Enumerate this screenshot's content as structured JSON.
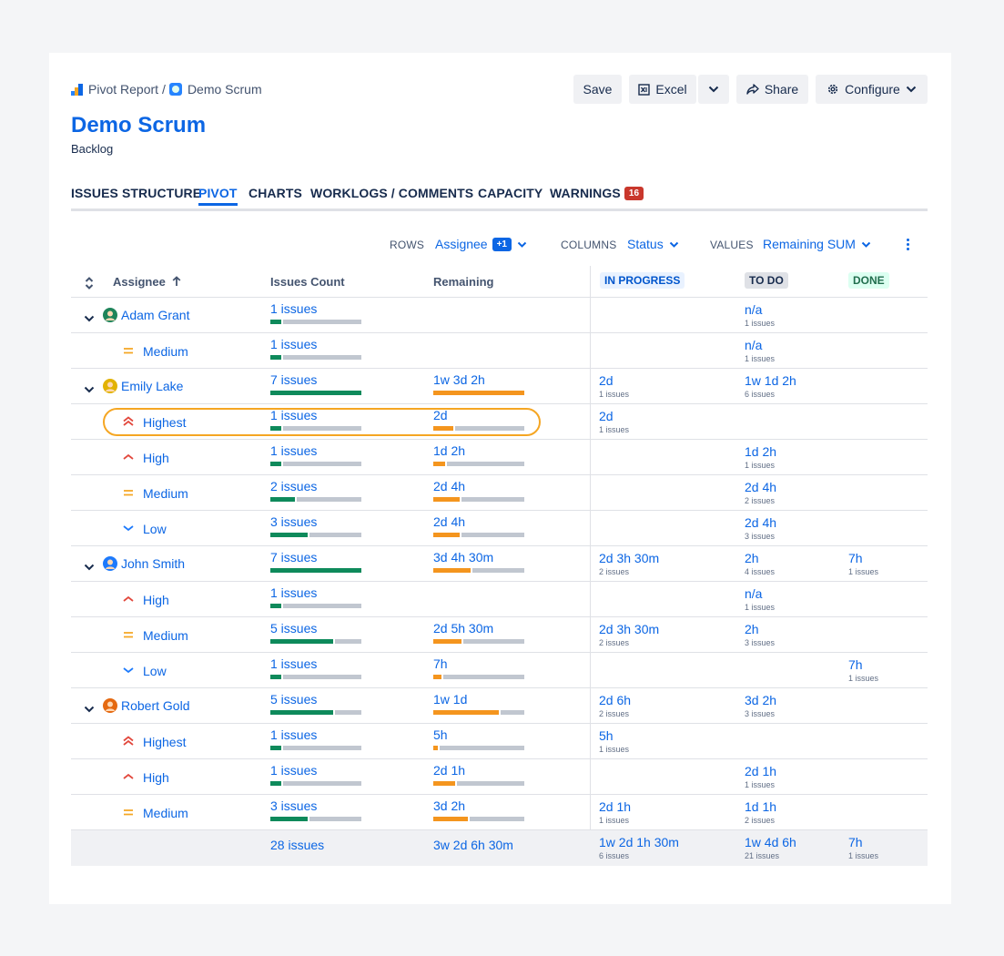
{
  "breadcrumbs": {
    "app": "Pivot Report",
    "separator": "/",
    "project": "Demo Scrum"
  },
  "toolbar": {
    "save": "Save",
    "excel": "Excel",
    "share": "Share",
    "configure": "Configure"
  },
  "page": {
    "title": "Demo Scrum",
    "subtitle": "Backlog"
  },
  "tabs": [
    {
      "label": "ISSUES STRUCTURE",
      "active": false
    },
    {
      "label": "PIVOT",
      "active": true
    },
    {
      "label": "CHARTS",
      "active": false
    },
    {
      "label": "WORKLOGS / COMMENTS",
      "active": false
    },
    {
      "label": "CAPACITY",
      "active": false
    },
    {
      "label": "WARNINGS",
      "active": false,
      "badge": "16"
    }
  ],
  "controls": {
    "rows_label": "ROWS",
    "rows_value": "Assignee",
    "rows_extra": "+1",
    "columns_label": "COLUMNS",
    "columns_value": "Status",
    "values_label": "VALUES",
    "values_value": "Remaining SUM"
  },
  "table": {
    "headers": {
      "assignee": "Assignee",
      "count": "Issues Count",
      "remaining": "Remaining",
      "in_progress": "IN PROGRESS",
      "todo": "TO DO",
      "done": "DONE"
    },
    "colors": {
      "count_bar": "#0e8a5b",
      "remaining_bar": "#f4951e",
      "link": "#0c66e4",
      "highlight": "#f5a623"
    },
    "rows": [
      {
        "level": 0,
        "label": "Adam Grant",
        "avatar": "#1f845a",
        "count": "1 issues",
        "count_pct": 0.14,
        "remaining": "",
        "remaining_pct": null,
        "ip": "",
        "ip_sub": "",
        "todo": "n/a",
        "todo_sub": "1 issues",
        "done": "",
        "done_sub": ""
      },
      {
        "level": 1,
        "label": "Medium",
        "priority": "medium",
        "count": "1 issues",
        "count_pct": 0.14,
        "remaining": "",
        "remaining_pct": null,
        "ip": "",
        "ip_sub": "",
        "todo": "n/a",
        "todo_sub": "1 issues",
        "done": "",
        "done_sub": ""
      },
      {
        "level": 0,
        "label": "Emily Lake",
        "avatar": "#e2b203",
        "count": "7 issues",
        "count_pct": 1.0,
        "remaining": "1w 3d 2h",
        "remaining_pct": 1.0,
        "ip": "2d",
        "ip_sub": "1 issues",
        "todo": "1w 1d 2h",
        "todo_sub": "6 issues",
        "done": "",
        "done_sub": ""
      },
      {
        "level": 1,
        "label": "Highest",
        "priority": "highest",
        "highlight": true,
        "count": "1 issues",
        "count_pct": 0.14,
        "remaining": "2d",
        "remaining_pct": 0.24,
        "ip": "2d",
        "ip_sub": "1 issues",
        "todo": "",
        "todo_sub": "",
        "done": "",
        "done_sub": ""
      },
      {
        "level": 1,
        "label": "High",
        "priority": "high",
        "count": "1 issues",
        "count_pct": 0.14,
        "remaining": "1d 2h",
        "remaining_pct": 0.15,
        "ip": "",
        "ip_sub": "",
        "todo": "1d 2h",
        "todo_sub": "1 issues",
        "done": "",
        "done_sub": ""
      },
      {
        "level": 1,
        "label": "Medium",
        "priority": "medium",
        "count": "2 issues",
        "count_pct": 0.29,
        "remaining": "2d 4h",
        "remaining_pct": 0.31,
        "ip": "",
        "ip_sub": "",
        "todo": "2d 4h",
        "todo_sub": "2 issues",
        "done": "",
        "done_sub": ""
      },
      {
        "level": 1,
        "label": "Low",
        "priority": "low",
        "count": "3 issues",
        "count_pct": 0.43,
        "remaining": "2d 4h",
        "remaining_pct": 0.31,
        "ip": "",
        "ip_sub": "",
        "todo": "2d 4h",
        "todo_sub": "3 issues",
        "done": "",
        "done_sub": ""
      },
      {
        "level": 0,
        "label": "John Smith",
        "avatar": "#1d7afc",
        "count": "7 issues",
        "count_pct": 1.0,
        "remaining": "3d 4h 30m",
        "remaining_pct": 0.43,
        "ip": "2d 3h 30m",
        "ip_sub": "2 issues",
        "todo": "2h",
        "todo_sub": "4 issues",
        "done": "7h",
        "done_sub": "1 issues"
      },
      {
        "level": 1,
        "label": "High",
        "priority": "high",
        "count": "1 issues",
        "count_pct": 0.14,
        "remaining": "",
        "remaining_pct": null,
        "ip": "",
        "ip_sub": "",
        "todo": "n/a",
        "todo_sub": "1 issues",
        "done": "",
        "done_sub": ""
      },
      {
        "level": 1,
        "label": "Medium",
        "priority": "medium",
        "count": "5 issues",
        "count_pct": 0.71,
        "remaining": "2d 5h 30m",
        "remaining_pct": 0.33,
        "ip": "2d 3h 30m",
        "ip_sub": "2 issues",
        "todo": "2h",
        "todo_sub": "3 issues",
        "done": "",
        "done_sub": ""
      },
      {
        "level": 1,
        "label": "Low",
        "priority": "low",
        "count": "1 issues",
        "count_pct": 0.14,
        "remaining": "7h",
        "remaining_pct": 0.11,
        "ip": "",
        "ip_sub": "",
        "todo": "",
        "todo_sub": "",
        "done": "7h",
        "done_sub": "1 issues"
      },
      {
        "level": 0,
        "label": "Robert Gold",
        "avatar": "#e56910",
        "count": "5 issues",
        "count_pct": 0.71,
        "remaining": "1w 1d",
        "remaining_pct": 0.74,
        "ip": "2d 6h",
        "ip_sub": "2 issues",
        "todo": "3d 2h",
        "todo_sub": "3 issues",
        "done": "",
        "done_sub": ""
      },
      {
        "level": 1,
        "label": "Highest",
        "priority": "highest",
        "count": "1 issues",
        "count_pct": 0.14,
        "remaining": "5h",
        "remaining_pct": 0.07,
        "ip": "5h",
        "ip_sub": "1 issues",
        "todo": "",
        "todo_sub": "",
        "done": "",
        "done_sub": ""
      },
      {
        "level": 1,
        "label": "High",
        "priority": "high",
        "count": "1 issues",
        "count_pct": 0.14,
        "remaining": "2d 1h",
        "remaining_pct": 0.26,
        "ip": "",
        "ip_sub": "",
        "todo": "2d 1h",
        "todo_sub": "1 issues",
        "done": "",
        "done_sub": ""
      },
      {
        "level": 1,
        "label": "Medium",
        "priority": "medium",
        "count": "3 issues",
        "count_pct": 0.43,
        "remaining": "3d 2h",
        "remaining_pct": 0.4,
        "ip": "2d 1h",
        "ip_sub": "1 issues",
        "todo": "1d 1h",
        "todo_sub": "2 issues",
        "done": "",
        "done_sub": ""
      }
    ],
    "total": {
      "count": "28 issues",
      "remaining": "3w 2d 6h 30m",
      "ip": "1w 2d 1h 30m",
      "ip_sub": "6 issues",
      "todo": "1w 4d 6h",
      "todo_sub": "21 issues",
      "done": "7h",
      "done_sub": "1 issues"
    }
  }
}
